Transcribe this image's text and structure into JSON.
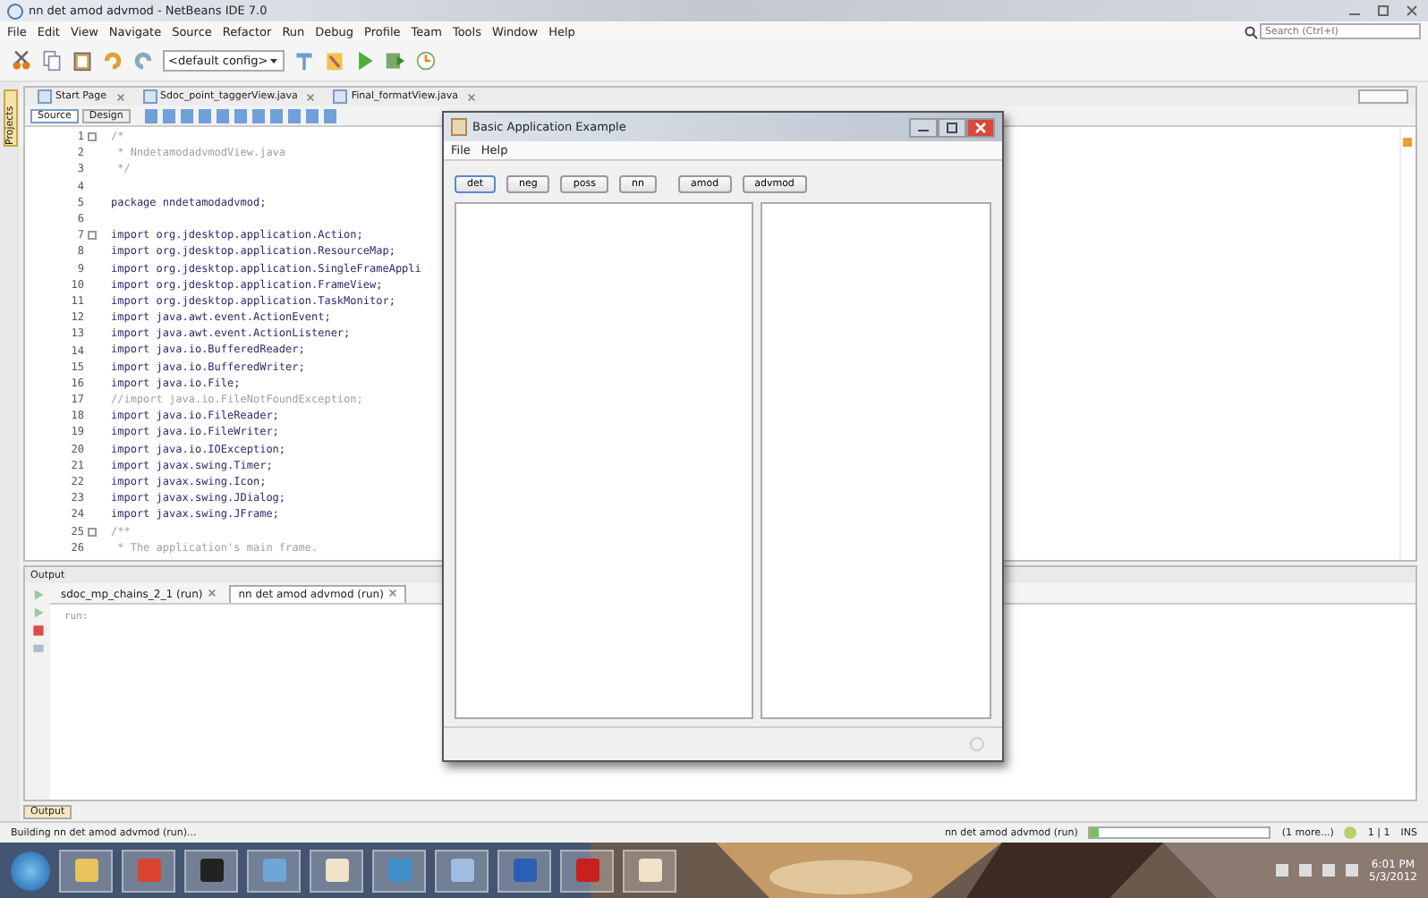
{
  "window": {
    "title": "nn det amod advmod - NetBeans IDE 7.0"
  },
  "menu": [
    "File",
    "Edit",
    "View",
    "Navigate",
    "Source",
    "Refactor",
    "Run",
    "Debug",
    "Profile",
    "Team",
    "Tools",
    "Window",
    "Help"
  ],
  "search": {
    "placeholder": "Search (Ctrl+I)"
  },
  "toolbar": {
    "config": "<default config>"
  },
  "side_tabs": [
    "Projects"
  ],
  "editor_tabs": [
    {
      "label": "Start Page",
      "selected": false
    },
    {
      "label": "Sdoc_point_taggerView.java",
      "selected": false
    },
    {
      "label": "Final_formatView.java",
      "selected": false
    }
  ],
  "editor_modes": [
    {
      "label": "Source",
      "selected": true
    },
    {
      "label": "Design",
      "selected": false
    }
  ],
  "code": [
    {
      "number": "1",
      "text": "/*",
      "kind": "comment",
      "fold": true
    },
    {
      "number": "2",
      "text": " * NndetamodadvmodView.java",
      "kind": "comment",
      "fold": false
    },
    {
      "number": "3",
      "text": " */",
      "kind": "comment",
      "fold": false
    },
    {
      "number": "4",
      "kind": "blank",
      "fold": false
    },
    {
      "number": "5",
      "text": "package nndetamodadvmod;",
      "kind": "code",
      "fold": false
    },
    {
      "number": "6",
      "kind": "blank",
      "fold": false
    },
    {
      "number": "7",
      "text": "import org.jdesktop.application.Action;",
      "kind": "code",
      "fold": true
    },
    {
      "number": "8",
      "text": "import org.jdesktop.application.ResourceMap;",
      "kind": "code",
      "fold": false
    },
    {
      "number": "9",
      "text": "import org.jdesktop.application.SingleFrameAppli",
      "kind": "code",
      "fold": false
    },
    {
      "number": "10",
      "text": "import org.jdesktop.application.FrameView;",
      "kind": "code",
      "fold": false
    },
    {
      "number": "11",
      "text": "import org.jdesktop.application.TaskMonitor;",
      "kind": "code",
      "fold": false
    },
    {
      "number": "12",
      "text": "import java.awt.event.ActionEvent;",
      "kind": "code",
      "fold": false
    },
    {
      "number": "13",
      "text": "import java.awt.event.ActionListener;",
      "kind": "code",
      "fold": false
    },
    {
      "number": "14",
      "text": "import java.io.BufferedReader;",
      "kind": "code",
      "fold": false
    },
    {
      "number": "15",
      "text": "import java.io.BufferedWriter;",
      "kind": "code",
      "fold": false
    },
    {
      "number": "16",
      "text": "import java.io.File;",
      "kind": "code",
      "fold": false
    },
    {
      "number": "17",
      "text": "//import java.io.FileNotFoundException;",
      "kind": "comment",
      "fold": false
    },
    {
      "number": "18",
      "text": "import java.io.FileReader;",
      "kind": "code",
      "fold": false
    },
    {
      "number": "19",
      "text": "import java.io.FileWriter;",
      "kind": "code",
      "fold": false
    },
    {
      "number": "20",
      "text": "import java.io.IOException;",
      "kind": "code",
      "fold": false
    },
    {
      "number": "21",
      "text": "import javax.swing.Timer;",
      "kind": "code",
      "fold": false
    },
    {
      "number": "22",
      "text": "import javax.swing.Icon;",
      "kind": "code",
      "fold": false
    },
    {
      "number": "23",
      "text": "import javax.swing.JDialog;",
      "kind": "code",
      "fold": false
    },
    {
      "number": "24",
      "text": "import javax.swing.JFrame;",
      "kind": "code",
      "fold": false
    },
    {
      "number": "25",
      "text": "/**",
      "kind": "comment",
      "fold": true
    },
    {
      "number": "26",
      "text": " * The application's main frame.",
      "kind": "comment",
      "fold": false
    }
  ],
  "output": {
    "title": "Output",
    "tabs": [
      {
        "label": "sdoc_mp_chains_2_1 (run)",
        "selected": false
      },
      {
        "label": "nn det amod advmod (run)",
        "selected": true
      }
    ],
    "lines": [
      "run:"
    ]
  },
  "output_button": "Output",
  "status": {
    "message": "Building nn det amod advmod (run)...",
    "task": "nn det amod advmod (run)",
    "level": 0.05,
    "more": "(1 more...)",
    "position": "1 | 1",
    "mode": "INS"
  },
  "dialog": {
    "title": "Basic Application Example",
    "menu": [
      "File",
      "Help"
    ],
    "buttons": [
      {
        "label": "det",
        "selected": true
      },
      {
        "label": "neg",
        "selected": false
      },
      {
        "label": "poss",
        "selected": false
      },
      {
        "label": "nn",
        "selected": false
      },
      {
        "label": "amod",
        "selected": false
      },
      {
        "label": "advmod",
        "selected": false
      }
    ]
  },
  "taskbar": {
    "apps": [
      {
        "kind": "folder"
      },
      {
        "kind": "browser"
      },
      {
        "kind": "game"
      },
      {
        "kind": "cube"
      },
      {
        "kind": "java"
      },
      {
        "kind": "media"
      },
      {
        "kind": "window"
      },
      {
        "kind": "word"
      },
      {
        "kind": "pdf"
      },
      {
        "kind": "java"
      }
    ],
    "time": "6:01 PM",
    "date": "5/3/2012"
  }
}
